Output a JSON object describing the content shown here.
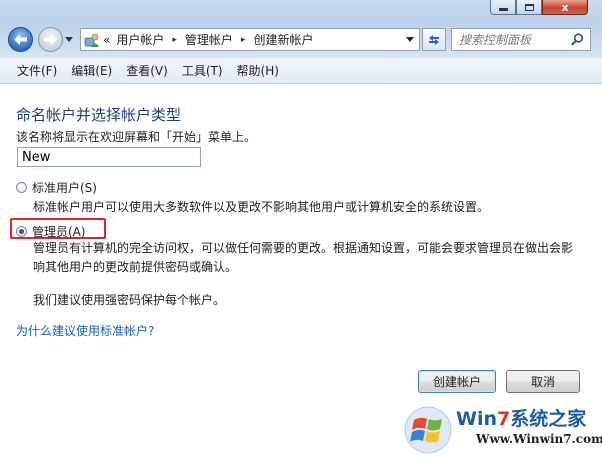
{
  "window": {
    "close_glyph": "x"
  },
  "address_bar": {
    "lead": "«",
    "crumbs": [
      "用户帐户",
      "管理帐户",
      "创建新帐户"
    ],
    "separator": "▸"
  },
  "search": {
    "placeholder": "搜索控制面板"
  },
  "menu": {
    "items": [
      "文件(F)",
      "编辑(E)",
      "查看(V)",
      "工具(T)",
      "帮助(H)"
    ]
  },
  "main": {
    "title": "命名帐户并选择帐户类型",
    "name_label": "该名称将显示在欢迎屏幕和「开始」菜单上。",
    "name_value": "New",
    "standard_user": {
      "label": "标准用户(S)",
      "description": "标准帐户用户可以使用大多数软件以及更改不影响其他用户或计算机安全的系统设置。",
      "selected": false
    },
    "administrator": {
      "label": "管理员(A)",
      "description_line1": "管理员有计算机的完全访问权，可以做任何需要的更改。根据通知设置，可能会要求管理员在做出会影",
      "description_line2": "响其他用户的更改前提供密码或确认。",
      "selected": true
    },
    "recommendation": "我们建议使用强密码保护每个帐户。",
    "why_link": "为什么建议使用标准帐户?"
  },
  "buttons": {
    "create": "创建帐户",
    "cancel": "取消"
  },
  "watermark": {
    "brand_prefix": "Win",
    "brand_number": "7",
    "brand_suffix": "系统之家",
    "url": "Www.Winwin7.com"
  },
  "colors": {
    "title": "#1e3f7a",
    "link": "#0f5fcb",
    "highlight": "#d9262b",
    "watermark_blue": "#1d5aa8"
  }
}
